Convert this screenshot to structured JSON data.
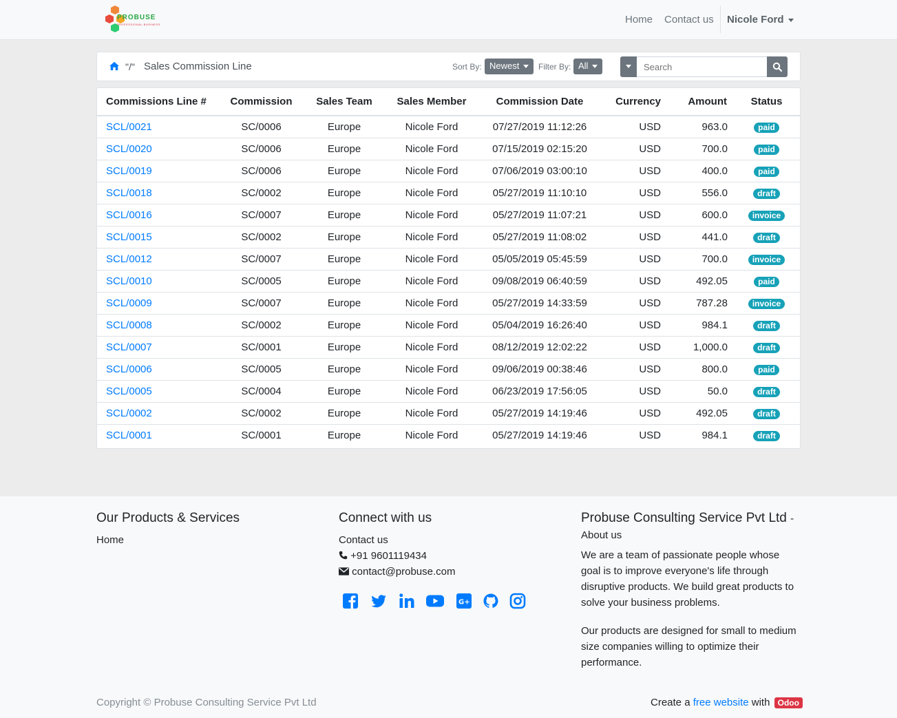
{
  "brand": {
    "name": "PROBUSE",
    "tagline": "PROFESSIONAL BUSINESS"
  },
  "nav": {
    "home": "Home",
    "contact": "Contact us",
    "user": "Nicole Ford"
  },
  "breadcrumb": {
    "separator": "\"/\"",
    "title": "Sales Commission Line"
  },
  "toolbar": {
    "sort_label": "Sort By:",
    "sort_value": "Newest",
    "filter_label": "Filter By:",
    "filter_value": "All",
    "search_placeholder": "Search"
  },
  "table": {
    "headers": [
      "Commissions Line #",
      "Commission",
      "Sales Team",
      "Sales Member",
      "Commission Date",
      "Currency",
      "Amount",
      "Status"
    ],
    "rows": [
      [
        "SCL/0021",
        "SC/0006",
        "Europe",
        "Nicole Ford",
        "07/27/2019 11:12:26",
        "USD",
        "963.0",
        "paid"
      ],
      [
        "SCL/0020",
        "SC/0006",
        "Europe",
        "Nicole Ford",
        "07/15/2019 02:15:20",
        "USD",
        "700.0",
        "paid"
      ],
      [
        "SCL/0019",
        "SC/0006",
        "Europe",
        "Nicole Ford",
        "07/06/2019 03:00:10",
        "USD",
        "400.0",
        "paid"
      ],
      [
        "SCL/0018",
        "SC/0002",
        "Europe",
        "Nicole Ford",
        "05/27/2019 11:10:10",
        "USD",
        "556.0",
        "draft"
      ],
      [
        "SCL/0016",
        "SC/0007",
        "Europe",
        "Nicole Ford",
        "05/27/2019 11:07:21",
        "USD",
        "600.0",
        "invoice"
      ],
      [
        "SCL/0015",
        "SC/0002",
        "Europe",
        "Nicole Ford",
        "05/27/2019 11:08:02",
        "USD",
        "441.0",
        "draft"
      ],
      [
        "SCL/0012",
        "SC/0007",
        "Europe",
        "Nicole Ford",
        "05/05/2019 05:45:59",
        "USD",
        "700.0",
        "invoice"
      ],
      [
        "SCL/0010",
        "SC/0005",
        "Europe",
        "Nicole Ford",
        "09/08/2019 06:40:59",
        "USD",
        "492.05",
        "paid"
      ],
      [
        "SCL/0009",
        "SC/0007",
        "Europe",
        "Nicole Ford",
        "05/27/2019 14:33:59",
        "USD",
        "787.28",
        "invoice"
      ],
      [
        "SCL/0008",
        "SC/0002",
        "Europe",
        "Nicole Ford",
        "05/04/2019 16:26:40",
        "USD",
        "984.1",
        "draft"
      ],
      [
        "SCL/0007",
        "SC/0001",
        "Europe",
        "Nicole Ford",
        "08/12/2019 12:02:22",
        "USD",
        "1,000.0",
        "draft"
      ],
      [
        "SCL/0006",
        "SC/0005",
        "Europe",
        "Nicole Ford",
        "09/06/2019 00:38:46",
        "USD",
        "800.0",
        "paid"
      ],
      [
        "SCL/0005",
        "SC/0004",
        "Europe",
        "Nicole Ford",
        "06/23/2019 17:56:05",
        "USD",
        "50.0",
        "draft"
      ],
      [
        "SCL/0002",
        "SC/0002",
        "Europe",
        "Nicole Ford",
        "05/27/2019 14:19:46",
        "USD",
        "492.05",
        "draft"
      ],
      [
        "SCL/0001",
        "SC/0001",
        "Europe",
        "Nicole Ford",
        "05/27/2019 14:19:46",
        "USD",
        "984.1",
        "draft"
      ]
    ]
  },
  "footer": {
    "col1": {
      "heading": "Our Products & Services",
      "link": "Home"
    },
    "col2": {
      "heading": "Connect with us",
      "contact_link": "Contact us",
      "phone": "+91 9601119434",
      "email": "contact@probuse.com"
    },
    "col3": {
      "heading": "Probuse Consulting Service Pvt Ltd",
      "dash": "-",
      "about_link": "About us",
      "para1": "We are a team of passionate people whose goal is to improve everyone's life through disruptive products. We build great products to solve your business problems.",
      "para2": "Our products are designed for small to medium size companies willing to optimize their performance."
    },
    "copyright": "Copyright © Probuse Consulting Service Pvt Ltd",
    "made_with_prefix": "Create a",
    "made_with_link": "free website",
    "made_with_mid": "with",
    "odoo": "Odoo"
  },
  "colors": {
    "accent": "#007bff",
    "badge": "#17a2b8",
    "secondary": "#6c757d",
    "odoo": "#dc3545",
    "social": "#007bff"
  },
  "icons": {
    "breadcrumb": "home-icon",
    "search": "search-icon",
    "phone": "phone-icon",
    "email": "envelope-icon",
    "socials": [
      "facebook-icon",
      "twitter-icon",
      "linkedin-icon",
      "youtube-icon",
      "google-plus-icon",
      "github-icon",
      "instagram-icon"
    ]
  }
}
